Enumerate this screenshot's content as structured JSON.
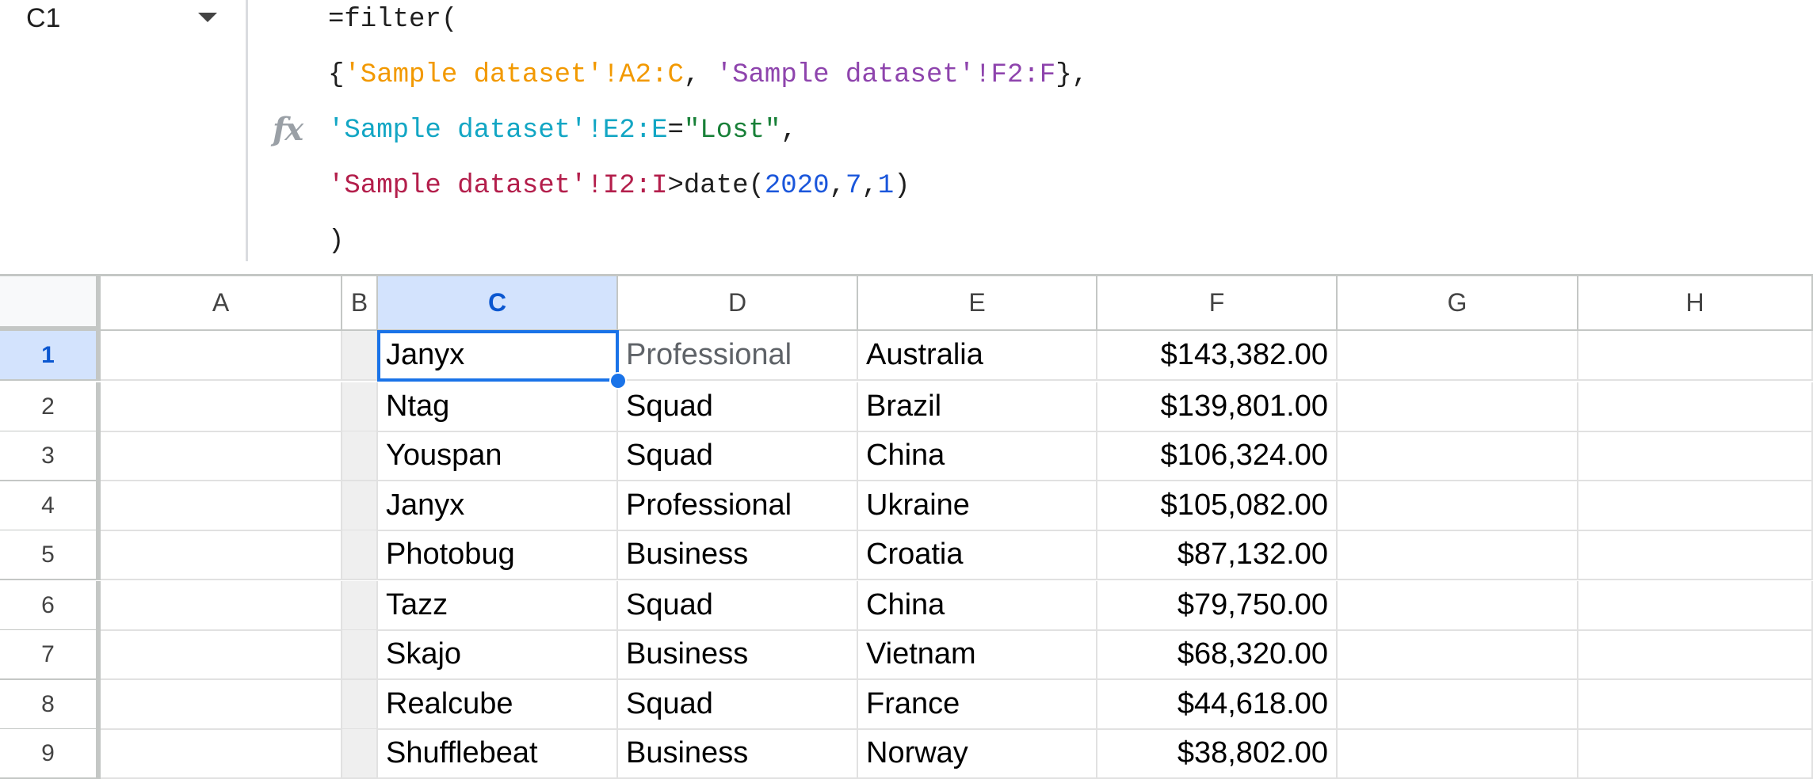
{
  "name_box": {
    "value": "C1"
  },
  "fx_label": "fx",
  "formula": {
    "line1": "=filter(",
    "line2": [
      {
        "text": "{",
        "c": ""
      },
      {
        "text": "'Sample dataset'!A2:C",
        "c": "c-orange"
      },
      {
        "text": ", ",
        "c": ""
      },
      {
        "text": "'Sample dataset'!F2:F",
        "c": "c-purple"
      },
      {
        "text": "},",
        "c": ""
      }
    ],
    "line3": [
      {
        "text": "'Sample dataset'!E2:E",
        "c": "c-teal"
      },
      {
        "text": "=",
        "c": ""
      },
      {
        "text": "\"Lost\"",
        "c": "c-green"
      },
      {
        "text": ",",
        "c": ""
      }
    ],
    "line4": [
      {
        "text": "'Sample dataset'!I2:I",
        "c": "c-red"
      },
      {
        "text": ">date(",
        "c": ""
      },
      {
        "text": "2020",
        "c": "c-blue"
      },
      {
        "text": ",",
        "c": ""
      },
      {
        "text": "7",
        "c": "c-blue"
      },
      {
        "text": ",",
        "c": ""
      },
      {
        "text": "1",
        "c": "c-blue"
      },
      {
        "text": ")",
        "c": ""
      }
    ],
    "line5": ")"
  },
  "columns": [
    "A",
    "B",
    "C",
    "D",
    "E",
    "F",
    "G",
    "H"
  ],
  "selected_column": "C",
  "selected_row": "1",
  "rows": [
    {
      "num": "1",
      "C": "Janyx",
      "D": "Professional",
      "E": "Australia",
      "F": "$143,382.00"
    },
    {
      "num": "2",
      "C": "Ntag",
      "D": "Squad",
      "E": "Brazil",
      "F": "$139,801.00"
    },
    {
      "num": "3",
      "C": "Youspan",
      "D": "Squad",
      "E": "China",
      "F": "$106,324.00"
    },
    {
      "num": "4",
      "C": "Janyx",
      "D": "Professional",
      "E": "Ukraine",
      "F": "$105,082.00"
    },
    {
      "num": "5",
      "C": "Photobug",
      "D": "Business",
      "E": "Croatia",
      "F": "$87,132.00"
    },
    {
      "num": "6",
      "C": "Tazz",
      "D": "Squad",
      "E": "China",
      "F": "$79,750.00"
    },
    {
      "num": "7",
      "C": "Skajo",
      "D": "Business",
      "E": "Vietnam",
      "F": "$68,320.00"
    },
    {
      "num": "8",
      "C": "Realcube",
      "D": "Squad",
      "E": "France",
      "F": "$44,618.00"
    },
    {
      "num": "9",
      "C": "Shufflebeat",
      "D": "Business",
      "E": "Norway",
      "F": "$38,802.00"
    }
  ],
  "colors": {
    "selection": "#1a73e8",
    "header_selected_bg": "#d3e3fd"
  }
}
